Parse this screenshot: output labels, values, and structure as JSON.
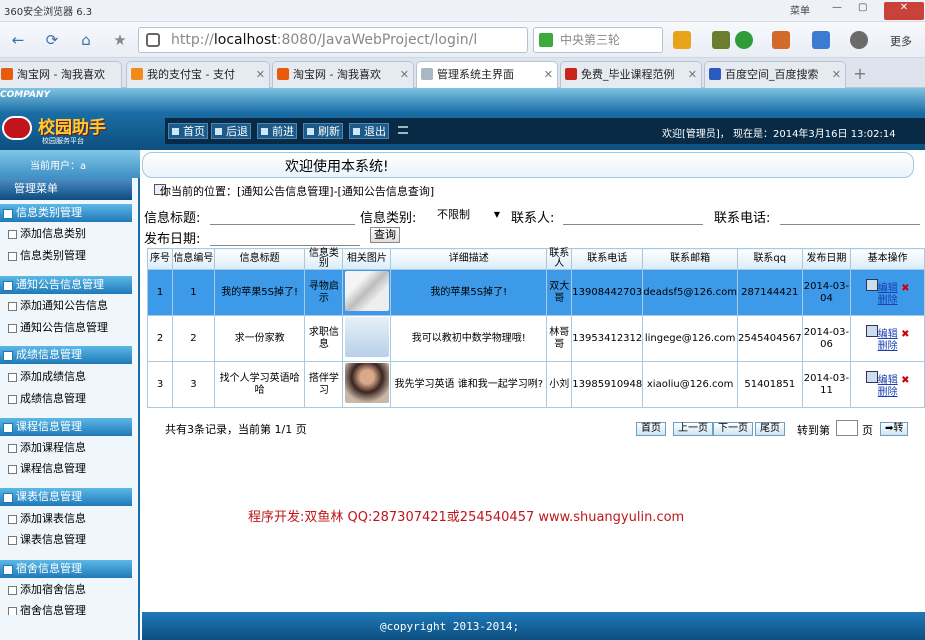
{
  "browser": {
    "title": "360安全浏览器 6.3",
    "menu_label": "菜单",
    "url_prefix": "http://",
    "url_host": "localhost",
    "url_rest": ":8080/JavaWebProject/login/l",
    "search_text": "中央第三轮",
    "more_label": "更多",
    "tabs": [
      {
        "label": "淘宝网 - 淘我喜欢",
        "color": "#e85a0c"
      },
      {
        "label": "我的支付宝 - 支付",
        "color": "#f08a1a"
      },
      {
        "label": "淘宝网 - 淘我喜欢",
        "color": "#e85a0c"
      },
      {
        "label": "管理系统主界面",
        "color": "#a9b6c6"
      },
      {
        "label": "免费_毕业课程范例",
        "color": "#c8261c"
      },
      {
        "label": "百度空间_百度搜索",
        "color": "#2a5bbf"
      }
    ]
  },
  "app": {
    "company": "COMPANY",
    "logo_text": "校园助手",
    "logo_sub": "校园服务平台",
    "nav": [
      "首页",
      "后退",
      "前进",
      "刷新",
      "退出"
    ],
    "welcome_user": "欢迎[管理员]， 现在是：2014年3月16日 13:02:14",
    "current_user_label": "当前用户：a",
    "menu_title": "管理菜单",
    "welcome_banner": "欢迎使用本系统!",
    "location": "你当前的位置：[通知公告信息管理]-[通知公告信息查询]",
    "copyright": "@copyright 2013-2014;",
    "credit": "程序开发:双鱼林 QQ:287307421或254540457 www.shuangyulin.com"
  },
  "menu": [
    {
      "title": "信息类别管理",
      "items": [
        "添加信息类别",
        "信息类别管理"
      ]
    },
    {
      "title": "通知公告信息管理",
      "items": [
        "添加通知公告信息",
        "通知公告信息管理"
      ]
    },
    {
      "title": "成绩信息管理",
      "items": [
        "添加成绩信息",
        "成绩信息管理"
      ]
    },
    {
      "title": "课程信息管理",
      "items": [
        "添加课程信息",
        "课程信息管理"
      ]
    },
    {
      "title": "课表信息管理",
      "items": [
        "添加课表信息",
        "课表信息管理"
      ]
    },
    {
      "title": "宿舍信息管理",
      "items": [
        "添加宿舍信息",
        "宿舍信息管理"
      ]
    }
  ],
  "filters": {
    "title_label": "信息标题:",
    "category_label": "信息类别:",
    "category_value": "不限制",
    "contact_label": "联系人:",
    "phone_label": "联系电话:",
    "date_label": "发布日期:",
    "query_button": "查询"
  },
  "table": {
    "headers": [
      "序号",
      "信息编号",
      "信息标题",
      "信息类别",
      "相关图片",
      "详细描述",
      "联系人",
      "联系电话",
      "联系邮箱",
      "联系qq",
      "发布日期",
      "基本操作"
    ],
    "rows": [
      {
        "seq": "1",
        "id": "1",
        "title": "我的苹果5S掉了!",
        "cat": "寻物启示",
        "desc": "我的苹果5S掉了!",
        "contact": "双大哥",
        "phone": "13908442703",
        "email": "deadsf5@126.com",
        "qq": "287144421",
        "date": "2014-03-04",
        "edit": "编辑",
        "del": "删除"
      },
      {
        "seq": "2",
        "id": "2",
        "title": "求一份家教",
        "cat": "求职信息",
        "desc": "我可以教初中数学物理哦!",
        "contact": "林哥哥",
        "phone": "13953412312",
        "email": "lingege@126.com",
        "qq": "2545404567",
        "date": "2014-03-06",
        "edit": "编辑",
        "del": "删除"
      },
      {
        "seq": "3",
        "id": "3",
        "title": "找个人学习英语哈哈",
        "cat": "搭伴学习",
        "desc": "我先学习英语 谁和我一起学习咧?",
        "contact": "小刘",
        "phone": "13985910948",
        "email": "xiaoliu@126.com",
        "qq": "51401851",
        "date": "2014-03-11",
        "edit": "编辑",
        "del": "删除"
      }
    ]
  },
  "pager": {
    "summary": "共有3条记录，当前第 1/1 页",
    "first": "首页",
    "prev": "上一页",
    "next": "下一页",
    "last": "尾页",
    "goto_label": "转到第",
    "page_unit": "页",
    "go": "转"
  }
}
